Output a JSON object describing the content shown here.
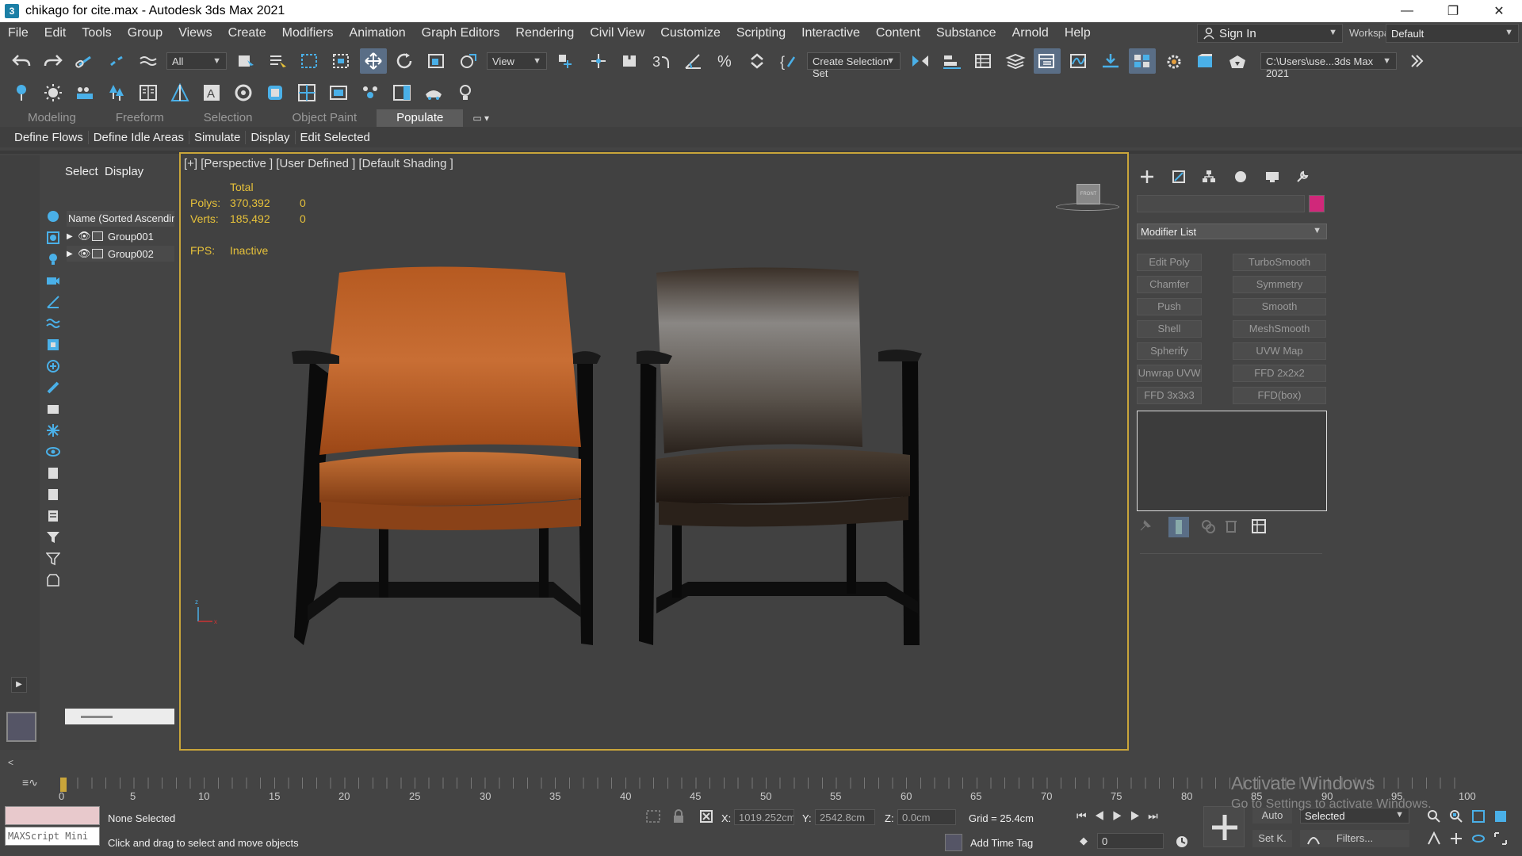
{
  "window": {
    "title": "chikago for cite.max - Autodesk 3ds Max 2021",
    "controls": [
      "—",
      "❐",
      "✕"
    ]
  },
  "menu": {
    "items": [
      "File",
      "Edit",
      "Tools",
      "Group",
      "Views",
      "Create",
      "Modifiers",
      "Animation",
      "Graph Editors",
      "Rendering",
      "Civil View",
      "Customize",
      "Scripting",
      "Interactive",
      "Content",
      "Substance",
      "Arnold",
      "Help"
    ],
    "sign_in": "Sign In",
    "workspaces_label": "Workspaces:",
    "workspace_value": "Default"
  },
  "toolbar": {
    "filter_value": "All",
    "ref_coord_value": "View",
    "selection_set": "Create Selection Set",
    "project_path": "C:\\Users\\use...3ds Max 2021"
  },
  "ribbon": {
    "tabs": [
      "Modeling",
      "Freeform",
      "Selection",
      "Object Paint",
      "Populate"
    ],
    "active_tab": "Populate",
    "sub_items": [
      "Define Flows",
      "Define Idle Areas",
      "Simulate",
      "Display",
      "Edit Selected"
    ]
  },
  "explorer": {
    "tab_select": "Select",
    "tab_display": "Display",
    "header": "Name (Sorted Ascending)",
    "rows": [
      "Group001",
      "Group002"
    ]
  },
  "viewport": {
    "label": "[+] [Perspective ] [User Defined ] [Default Shading ]",
    "total_label": "Total",
    "polys_label": "Polys:",
    "polys_value": "370,392",
    "polys_sel": "0",
    "verts_label": "Verts:",
    "verts_value": "185,492",
    "verts_sel": "0",
    "fps_label": "FPS:",
    "fps_value": "Inactive",
    "viewcube_label": "FRONT"
  },
  "command_panel": {
    "modifier_list": "Modifier List",
    "color_swatch": "#d0287a",
    "modifier_buttons": [
      "Edit Poly",
      "TurboSmooth",
      "Chamfer",
      "Symmetry",
      "Push",
      "Smooth",
      "Shell",
      "MeshSmooth",
      "Spherify",
      "UVW Map",
      "Unwrap UVW",
      "FFD 2x2x2",
      "FFD 3x3x3",
      "FFD(box)"
    ]
  },
  "timeline": {
    "ticks": [
      "0",
      "5",
      "10",
      "15",
      "20",
      "25",
      "30",
      "35",
      "40",
      "45",
      "50",
      "55",
      "60",
      "65",
      "70",
      "75",
      "80",
      "85",
      "90",
      "95",
      "100"
    ],
    "end_mark": "100"
  },
  "status": {
    "maxscript_label": "MAXScript Mini",
    "selection": "None Selected",
    "hint": "Click and drag to select and move objects",
    "x_label": "X:",
    "x_value": "1019.252cm",
    "y_label": "Y:",
    "y_value": "2542.8cm",
    "z_label": "Z:",
    "z_value": "0.0cm",
    "grid": "Grid = 25.4cm",
    "add_time_tag": "Add Time Tag",
    "auto_key": "Auto",
    "set_key": "Set K.",
    "key_filter_value": "Selected",
    "filters_label": "Filters...",
    "frame_value": "0"
  },
  "watermark": {
    "line1": "Activate Windows",
    "line2": "Go to Settings to activate Windows."
  },
  "colors": {
    "accent_active": "#5a6e86",
    "viewport_border": "#c9a53a",
    "stats_text": "#e6c13a",
    "icon_blue": "#4ab0e8"
  }
}
